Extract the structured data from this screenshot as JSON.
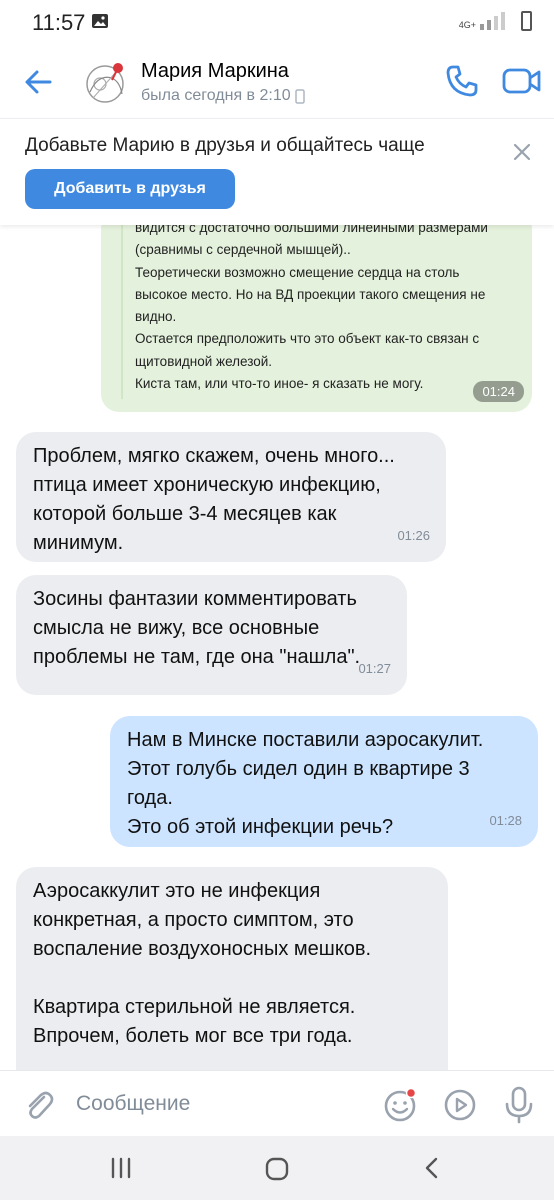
{
  "status_bar": {
    "time": "11:57",
    "network": "4G+"
  },
  "header": {
    "contact_name": "Мария Маркина",
    "last_seen": "была сегодня в 2:10"
  },
  "banner": {
    "text": "Добавьте Марию в друзья и общайтесь чаще",
    "add_button": "Добавить в друзья"
  },
  "forwarded": {
    "lines": [
      "видится с достаточно большими линейными размерами",
      "(сравнимы с сердечной мышцей)..",
      "Теоретически возможно смещение сердца на столь",
      "высокое место. Но на ВД проекции такого смещения не",
      "видно.",
      "Остается предположить что это объект как-то связан с",
      "щитовидной железой.",
      "Киста там, или что-то иное- я сказать не могу."
    ],
    "time": "01:24"
  },
  "messages": [
    {
      "direction": "in",
      "lines": [
        "Проблем, мягко скажем, очень много...",
        "птица имеет хроническую инфекцию,",
        "которой больше 3-4 месяцев как",
        "минимум."
      ],
      "time": "01:26"
    },
    {
      "direction": "in",
      "lines": [
        "Зосины фантазии комментировать",
        "смысла не вижу, все основные",
        "проблемы не там, где она \"нашла\"."
      ],
      "time": "01:27"
    },
    {
      "direction": "out",
      "lines": [
        "Нам в Минске поставили аэросакулит.",
        "Этот голубь сидел один в квартире 3",
        "года.",
        "Это об этой инфекции речь?"
      ],
      "time": "01:28"
    },
    {
      "direction": "in",
      "lines": [
        "Аэросаккулит это не инфекция",
        "конкретная, а просто симптом, это",
        "воспаление воздухоносных мешков.",
        "",
        "Квартира стерильной не является.",
        "Впрочем, болеть мог все три года."
      ],
      "time": ""
    }
  ],
  "composer": {
    "placeholder": "Сообщение"
  },
  "colors": {
    "accent": "#3f8ae0",
    "incoming_bubble": "#ebedf0",
    "outgoing_bubble": "#cce4ff",
    "forwarded_bubble": "#e4f1dc"
  }
}
